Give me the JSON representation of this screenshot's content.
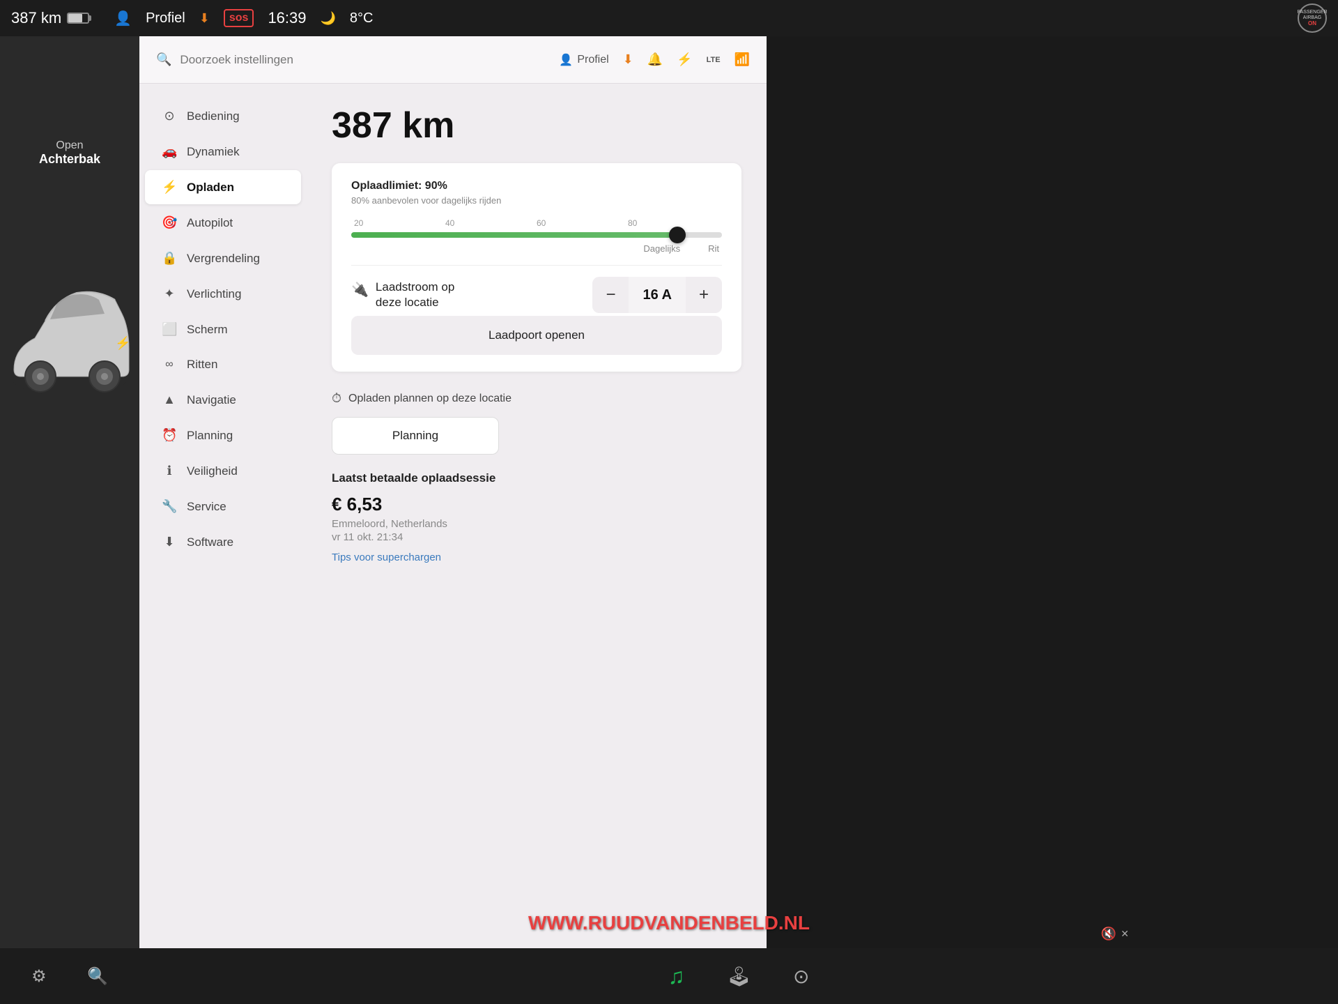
{
  "statusBar": {
    "range": "387 km",
    "profileLabel": "Profiel",
    "sos": "sos",
    "time": "16:39",
    "temp": "8°C",
    "airbag": {
      "line1": "PASSENGER",
      "line2": "AIRBAG",
      "line3": "ON"
    }
  },
  "search": {
    "placeholder": "Doorzoek instellingen",
    "profileLabel": "Profiel",
    "lte": "LTE"
  },
  "sidebar": {
    "items": [
      {
        "id": "bediening",
        "label": "Bediening",
        "icon": "⚙"
      },
      {
        "id": "dynamiek",
        "label": "Dynamiek",
        "icon": "🚗"
      },
      {
        "id": "opladen",
        "label": "Opladen",
        "icon": "⚡",
        "active": true
      },
      {
        "id": "autopilot",
        "label": "Autopilot",
        "icon": "🎯"
      },
      {
        "id": "vergrendeling",
        "label": "Vergrendeling",
        "icon": "🔒"
      },
      {
        "id": "verlichting",
        "label": "Verlichting",
        "icon": "✦"
      },
      {
        "id": "scherm",
        "label": "Scherm",
        "icon": "⬜"
      },
      {
        "id": "ritten",
        "label": "Ritten",
        "icon": "∞"
      },
      {
        "id": "navigatie",
        "label": "Navigatie",
        "icon": "▲"
      },
      {
        "id": "planning",
        "label": "Planning",
        "icon": "⏰"
      },
      {
        "id": "veiligheid",
        "label": "Veiligheid",
        "icon": "ℹ"
      },
      {
        "id": "service",
        "label": "Service",
        "icon": "🔧"
      },
      {
        "id": "software",
        "label": "Software",
        "icon": "⬇"
      }
    ]
  },
  "mainContent": {
    "rangeKm": "387 km",
    "chargeCard": {
      "limitLabel": "Oplaadlimiet: 90%",
      "limitSub": "80% aanbevolen voor dagelijks rijden",
      "sliderLabels": [
        "20",
        "40",
        "60",
        "80"
      ],
      "sliderPercent": 88,
      "dailyLabel": "Dagelijks",
      "ritLabel": "Rit",
      "currentLabel": "Laadstroom op\ndeze locatie",
      "currentValue": "16 A",
      "laadpoortBtn": "Laadpoort openen"
    },
    "scheduleSection": {
      "headerText": "Opladen plannen op deze locatie",
      "planningBtn": "Planning"
    },
    "lastSession": {
      "sectionLabel": "Laatst betaalde oplaadsessie",
      "amount": "€ 6,53",
      "location": "Emmeloord, Netherlands",
      "date": "vr 11 okt. 21:34",
      "tipsLink": "Tips voor superchargen"
    }
  },
  "carPanel": {
    "openLabel": "Open",
    "achterbakLabel": "Achterbak"
  },
  "watermark": "WWW.RUUDVANDENBELD.NL"
}
